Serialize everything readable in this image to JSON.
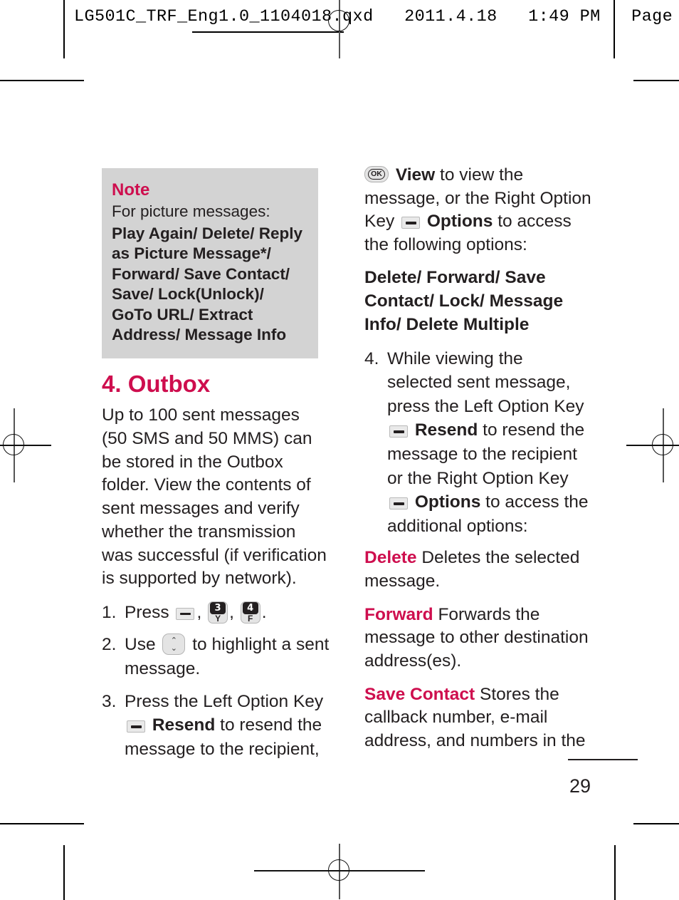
{
  "print_header": {
    "text": "LG501C_TRF_Eng1.0_1104018.qxd   2011.4.18   1:49 PM   Page"
  },
  "note": {
    "title": "Note",
    "lead": "For picture messages:",
    "options": "Play Again/ Delete/ Reply as Picture Message*/ Forward/ Save Contact/ Save/ Lock(Unlock)/ GoTo URL/ Extract Address/ Message Info"
  },
  "section": {
    "title": "4. Outbox",
    "intro": "Up to 100 sent messages (50 SMS and 50 MMS) can be stored in the Outbox folder. View the contents of sent messages and verify whether the transmission was successful (if verification is supported by network)."
  },
  "steps": {
    "s1": {
      "num": "1.",
      "text_before": "Press",
      "comma1": ",",
      "comma2": ",",
      "period": "."
    },
    "s2": {
      "num": "2.",
      "text_before": "Use",
      "text_after": "to highlight a sent message."
    },
    "s3": {
      "num": "3.",
      "text_before": "Press the Left Option Key",
      "label": "Resend",
      "text_after": "to resend the message to the recipient,"
    },
    "s4": {
      "num": "4.",
      "part1": "While viewing the selected sent message, press the Left Option Key",
      "label1": "Resend",
      "part2": "to resend the message to the recipient or the Right Option Key",
      "label2": "Options",
      "part3": "to access the additional options:"
    }
  },
  "right_intro": {
    "label_view": "View",
    "part1": "to view the message, or the Right Option Key",
    "label_options": "Options",
    "part2": "to access the following options:",
    "options_list": "Delete/ Forward/ Save Contact/ Lock/ Message Info/ Delete Multiple"
  },
  "definitions": [
    {
      "term": "Delete",
      "desc": "Deletes the selected message."
    },
    {
      "term": "Forward",
      "desc": "Forwards the message to other destination address(es)."
    },
    {
      "term": "Save Contact",
      "desc": "Stores the callback number, e-mail address, and numbers in the"
    }
  ],
  "keys": {
    "option_dash": "option-key",
    "key3": {
      "digit": "3",
      "letter": "Y"
    },
    "key4": {
      "digit": "4",
      "letter": "F"
    },
    "nav_up": "⌃",
    "nav_down": "⌄",
    "ok": "OK"
  },
  "footer": {
    "page_number": "29"
  },
  "colors": {
    "accent": "#ce0e4e",
    "text": "#231f20",
    "note_bg": "#d3d3d3"
  }
}
